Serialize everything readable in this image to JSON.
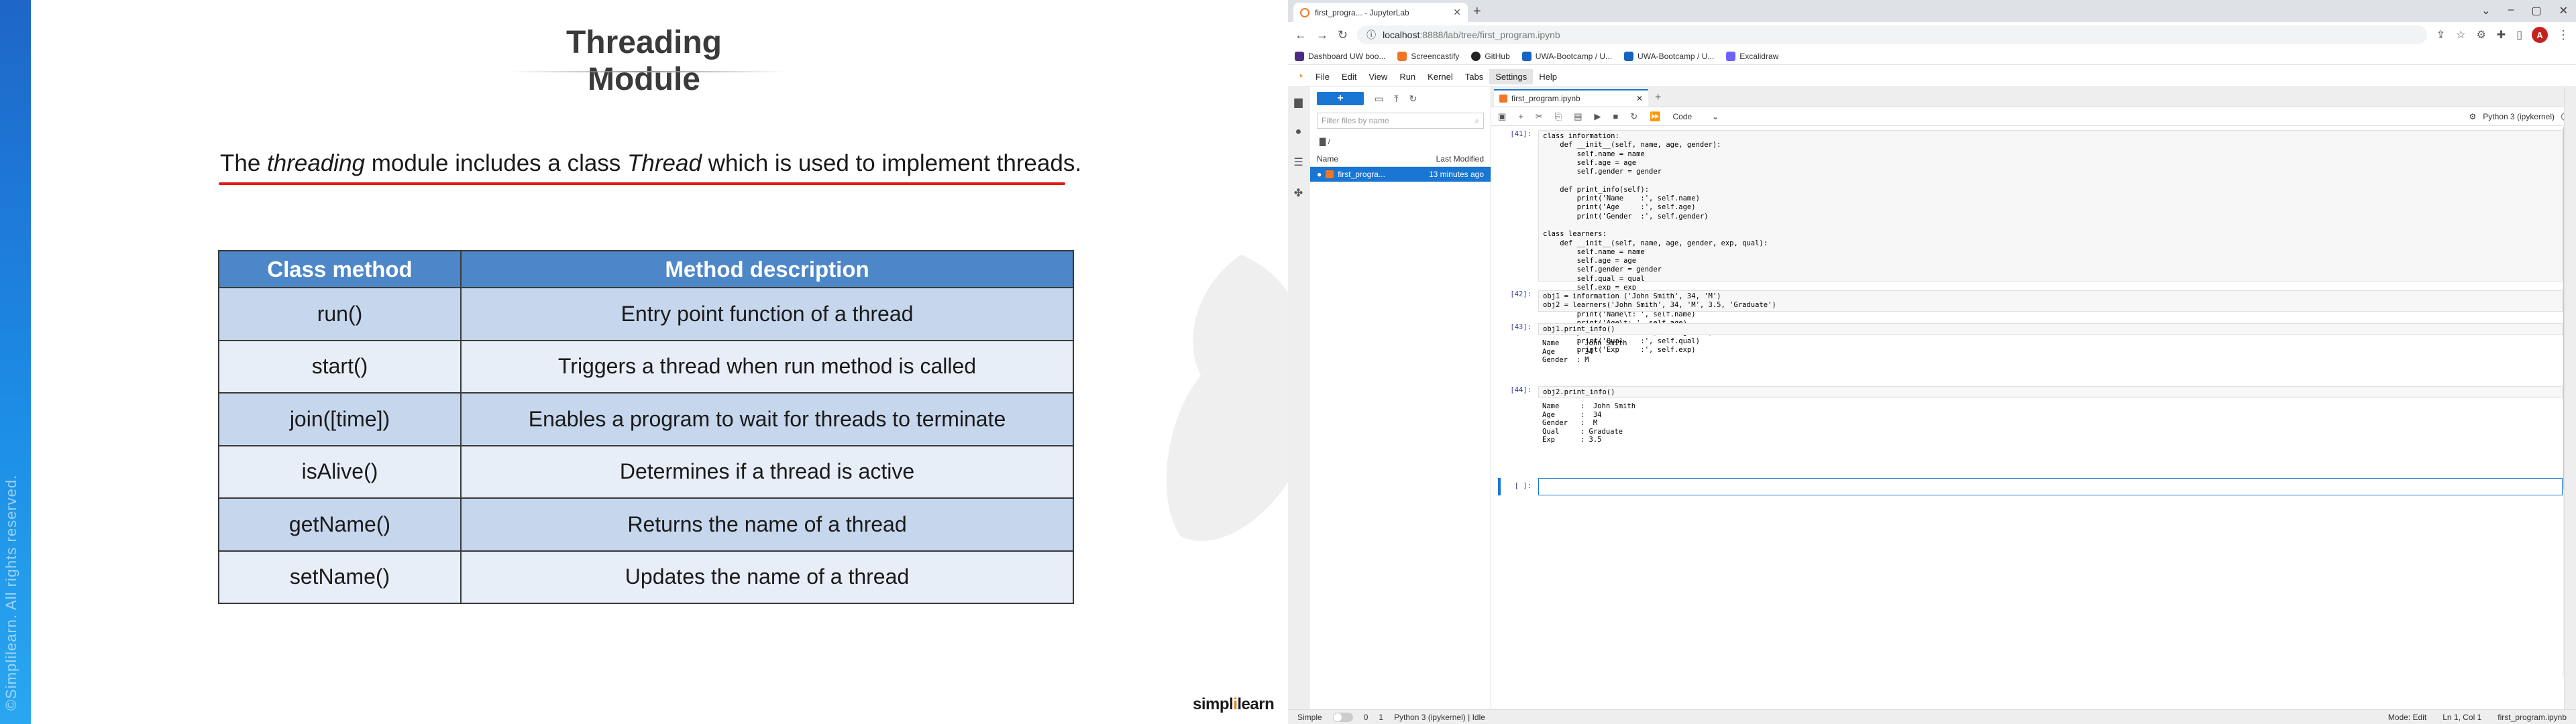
{
  "slide": {
    "title": "Threading Module",
    "intro": {
      "pre": "The ",
      "em1": "threading",
      "mid": " module includes a class ",
      "em2": "Thread",
      "post": " which is used to implement threads."
    },
    "table": {
      "headers": [
        "Class method",
        "Method description"
      ],
      "rows": [
        [
          "run()",
          "Entry point function of a thread"
        ],
        [
          "start()",
          "Triggers a thread when run method is called"
        ],
        [
          "join([time])",
          "Enables a program to wait for threads to terminate"
        ],
        [
          "isAlive()",
          "Determines if a thread is active"
        ],
        [
          "getName()",
          "Returns the name of a thread"
        ],
        [
          "setName()",
          "Updates the name of a thread"
        ]
      ]
    },
    "copyright": "©Simplilearn. All rights reserved.",
    "logo": {
      "part1": "simpl",
      "accent": "i",
      "part2": "learn"
    },
    "colors": {
      "header": "#4d87c7",
      "row_odd": "#c6d6ec",
      "row_even": "#e8eef7",
      "underline": "#e01919",
      "sidebar": "#1e66c8"
    }
  },
  "browser": {
    "tab_title": "first_progra... - JupyterLab",
    "url_host": "localhost",
    "url_path": ":8888/lab/tree/first_program.ipynb",
    "profile_initial": "A",
    "bookmarks": [
      {
        "label": "Dashboard UW boo...",
        "color": "#4b2e83"
      },
      {
        "label": "Screencastify",
        "color": "#f37626"
      },
      {
        "label": "GitHub",
        "color": "#222222"
      },
      {
        "label": "UWA-Bootcamp / U...",
        "color": "#1565c0"
      },
      {
        "label": "UWA-Bootcamp / U...",
        "color": "#1565c0"
      },
      {
        "label": "Excalidraw",
        "color": "#6c63ff"
      }
    ]
  },
  "jupyter": {
    "menus": [
      "File",
      "Edit",
      "View",
      "Run",
      "Kernel",
      "Tabs",
      "Settings",
      "Help"
    ],
    "active_menu": "Settings",
    "filter_placeholder": "Filter files by name",
    "crumb": "/",
    "fb_cols": [
      "Name",
      "Last Modified"
    ],
    "file": {
      "name": "first_progra...",
      "modified": "13 minutes ago"
    },
    "doc_tab": "first_program.ipynb",
    "cell_type": "Code",
    "kernel_name": "Python 3 (ipykernel)",
    "cells": [
      {
        "prompt": "[41]:",
        "code": "class information:\n    def __init__(self, name, age, gender):\n        self.name = name\n        self.age = age\n        self.gender = gender\n\n    def print_info(self):\n        print('Name    :', self.name)\n        print('Age     :', self.age)\n        print('Gender  :', self.gender)\n\nclass learners:\n    def __init__(self, name, age, gender, exp, qual):\n        self.name = name\n        self.age = age\n        self.gender = gender\n        self.qual = qual\n        self.exp = exp\n\n    def print_info(self):\n        print('Name\\t: ', self.name)\n        print('Age\\t: ', self.age)\n        print('Gender\\t: ', self.gender)\n        print('Qual    :', self.qual)\n        print('Exp     :', self.exp)"
      },
      {
        "prompt": "[42]:",
        "code": "obj1 = information ('John Smith', 34, 'M')\nobj2 = learners('John Smith', 34, 'M', 3.5, 'Graduate')"
      },
      {
        "prompt": "[43]:",
        "code": "obj1.print_info()",
        "output": "Name    : John Smith\nAge     : 34\nGender  : M"
      },
      {
        "prompt": "[44]:",
        "code": "obj2.print_info()",
        "output": "Name     :  John Smith\nAge      :  34\nGender   :  M\nQual     : Graduate\nExp      : 3.5"
      }
    ],
    "empty_prompt": "[ ]:",
    "status": {
      "mode_label": "Simple",
      "count1": "0",
      "count2": "1",
      "kernel_status": "Python 3 (ipykernel) | Idle",
      "edit_mode": "Mode: Edit",
      "position": "Ln 1, Col 1",
      "file": "first_program.ipynb"
    }
  }
}
